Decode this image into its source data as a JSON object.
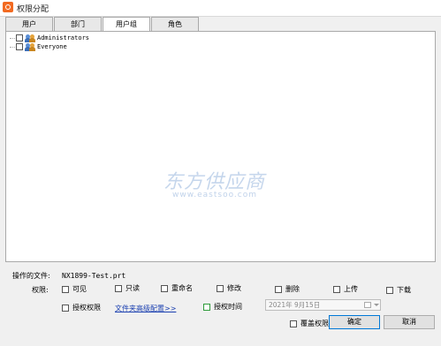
{
  "window": {
    "title": "权限分配"
  },
  "tabs": [
    {
      "label": "用户"
    },
    {
      "label": "部门"
    },
    {
      "label": "用户组"
    },
    {
      "label": "角色"
    }
  ],
  "tree": [
    {
      "label": "Administrators",
      "checked": false
    },
    {
      "label": "Everyone",
      "checked": false
    }
  ],
  "watermark": {
    "text": "东方供应商",
    "url": "www.eastsoo.com"
  },
  "file": {
    "label": "操作的文件:",
    "value": "NX1899-Test.prt"
  },
  "permissions": {
    "label": "权限:",
    "options": [
      {
        "label": "可见",
        "checked": false
      },
      {
        "label": "只读",
        "checked": false
      },
      {
        "label": "重命名",
        "checked": false
      },
      {
        "label": "修改",
        "checked": false
      },
      {
        "label": "删除",
        "checked": false
      },
      {
        "label": "上传",
        "checked": false
      },
      {
        "label": "下载",
        "checked": false
      }
    ],
    "grant_label": "授权权限",
    "advanced_link": "文件夹高级配置>>",
    "grant_time_label": "授权时间",
    "date_value": "2021年 9月15日"
  },
  "footer": {
    "overwrite_label": "覆盖权限",
    "ok_label": "确定",
    "cancel_label": "取消"
  },
  "colors": {
    "link": "#1a3fb0",
    "accent_border": "#0078d7",
    "app_icon": "#f26a21"
  }
}
